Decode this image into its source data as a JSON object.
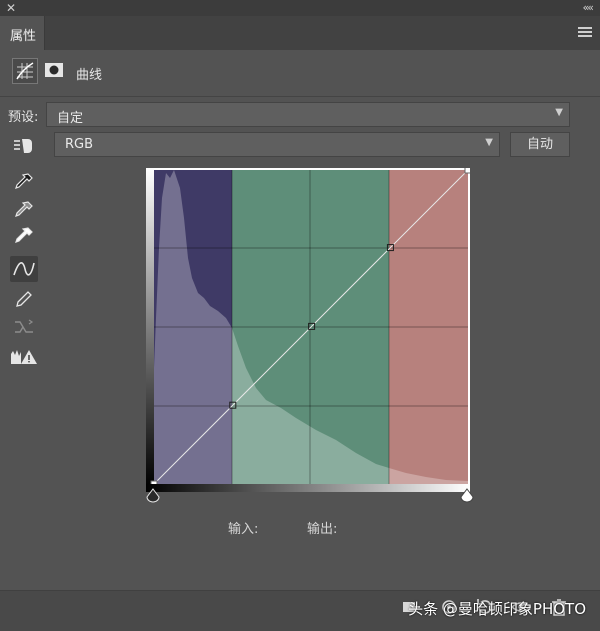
{
  "window": {
    "close_glyph": "✕",
    "collapse_glyph": "««"
  },
  "tab": {
    "label": "属性"
  },
  "header": {
    "title": "曲线",
    "icons": [
      "curves-adjustment-icon",
      "mask-icon"
    ]
  },
  "preset": {
    "label": "预设:",
    "value": "自定"
  },
  "channel": {
    "value": "RGB"
  },
  "auto_button": {
    "label": "自动"
  },
  "tools": [
    "on-image-adjust-icon",
    "black-point-eyedropper-icon",
    "gray-point-eyedropper-icon",
    "white-point-eyedropper-icon",
    "edit-points-icon",
    "pencil-icon",
    "smooth-icon",
    "clipping-warning-icon"
  ],
  "curve": {
    "points": [
      [
        0,
        0
      ],
      [
        64,
        64
      ],
      [
        128,
        128
      ],
      [
        192,
        192
      ],
      [
        255,
        255
      ]
    ],
    "zone_colors": [
      "#3f3a66",
      "#5e8e79",
      "#b7817d"
    ]
  },
  "io": {
    "input_label": "输入:",
    "output_label": "输出:"
  },
  "footer": {
    "watermark": "头条 @曼哈顿印象PHOTO"
  }
}
